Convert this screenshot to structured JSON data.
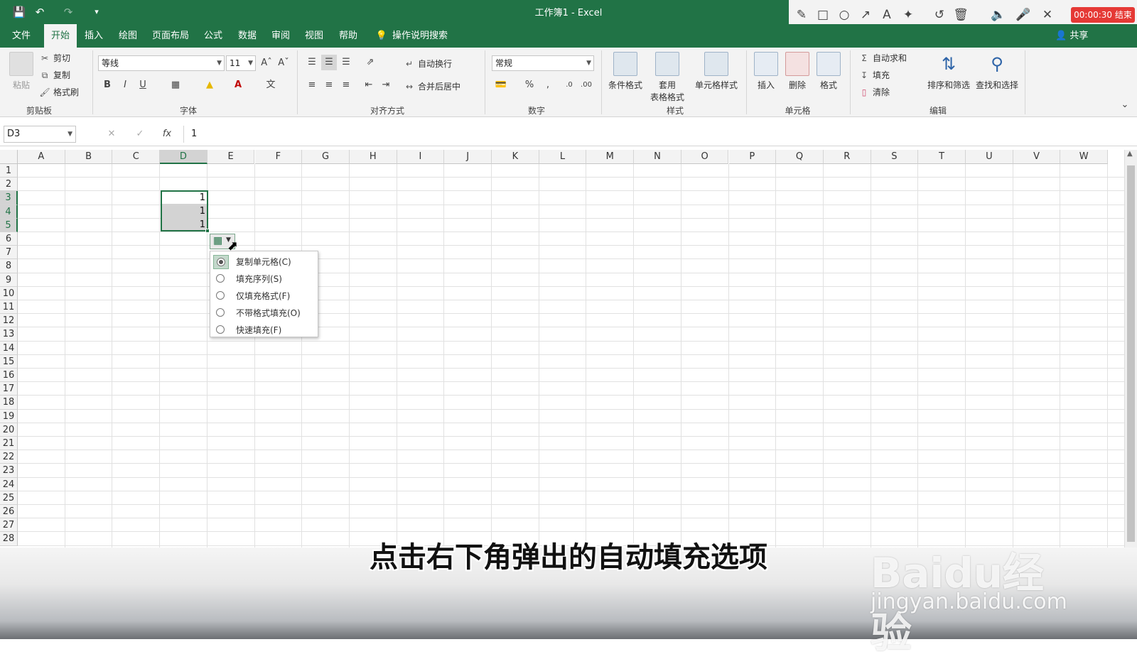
{
  "window": {
    "title": "工作簿1  -  Excel"
  },
  "recorder": {
    "timer": "00:00:30 结束"
  },
  "menu": {
    "tabs": [
      "文件",
      "开始",
      "插入",
      "绘图",
      "页面布局",
      "公式",
      "数据",
      "审阅",
      "视图",
      "帮助"
    ],
    "search": "操作说明搜索",
    "share": "共享"
  },
  "ribbon": {
    "clipboard": {
      "paste": "粘贴",
      "cut": "剪切",
      "copy": "复制",
      "format_painter": "格式刷",
      "label": "剪贴板"
    },
    "font": {
      "name": "等线",
      "size": "11",
      "label": "字体"
    },
    "alignment": {
      "wrap": "自动换行",
      "merge": "合并后居中",
      "label": "对齐方式"
    },
    "number": {
      "format": "常规",
      "label": "数字"
    },
    "styles": {
      "conditional": "条件格式",
      "table_line1": "套用",
      "table_line2": "表格格式",
      "cell_styles": "单元格样式",
      "label": "样式"
    },
    "cells": {
      "insert": "插入",
      "delete": "删除",
      "format": "格式",
      "label": "单元格"
    },
    "editing": {
      "autosum": "自动求和",
      "fill": "填充",
      "clear": "清除",
      "sort": "排序和筛选",
      "find": "查找和选择",
      "label": "编辑"
    }
  },
  "formula_bar": {
    "name_box": "D3",
    "value": "1"
  },
  "grid": {
    "columns": [
      "A",
      "B",
      "C",
      "D",
      "E",
      "F",
      "G",
      "H",
      "I",
      "J",
      "K",
      "L",
      "M",
      "N",
      "O",
      "P",
      "Q",
      "R",
      "S",
      "T",
      "U",
      "V",
      "W"
    ],
    "rows": [
      "1",
      "2",
      "3",
      "4",
      "5",
      "6",
      "7",
      "8",
      "9",
      "10",
      "11",
      "12",
      "13",
      "14",
      "15",
      "16",
      "17",
      "18",
      "19",
      "20",
      "21",
      "22",
      "23",
      "24",
      "25",
      "26",
      "27",
      "28"
    ],
    "selected_column": "D",
    "selected_rows": [
      "3",
      "4",
      "5"
    ],
    "cells": {
      "D3": "1",
      "D4": "1",
      "D5": "1"
    }
  },
  "autofill_menu": {
    "items": [
      "复制单元格(C)",
      "填充序列(S)",
      "仅填充格式(F)",
      "不带格式填充(O)",
      "快速填充(F)"
    ],
    "selected_index": 0
  },
  "subtitle": "点击右下角弹出的自动填充选项",
  "watermark": {
    "logo": "Baidu经验",
    "url": "jingyan.baidu.com"
  },
  "colors": {
    "accent": "#217346",
    "timer": "#e53935"
  }
}
